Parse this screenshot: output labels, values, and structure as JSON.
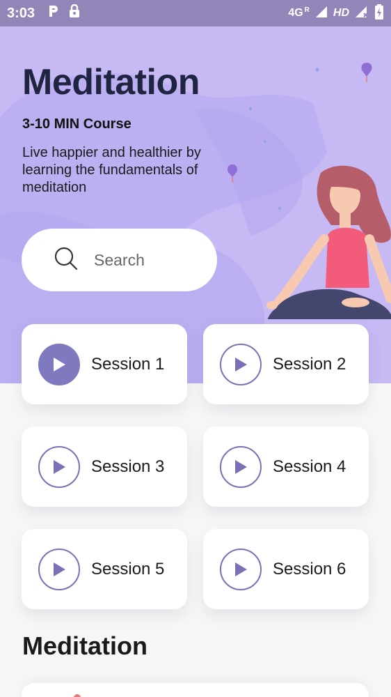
{
  "status_bar": {
    "time": "3:03",
    "network": "4G",
    "roaming": "R",
    "hd": "HD"
  },
  "hero": {
    "title": "Meditation",
    "subtitle": "3-10 MIN Course",
    "description": "Live happier and healthier by learning the fundamentals of meditation",
    "background_color": "#c6b9f4"
  },
  "search": {
    "placeholder": "Search"
  },
  "sessions": [
    {
      "label": "Session 1",
      "active": true
    },
    {
      "label": "Session 2",
      "active": false
    },
    {
      "label": "Session 3",
      "active": false
    },
    {
      "label": "Session 4",
      "active": false
    },
    {
      "label": "Session 5",
      "active": false
    },
    {
      "label": "Session 6",
      "active": false
    }
  ],
  "section": {
    "title": "Meditation"
  },
  "colors": {
    "accent": "#7f79c0",
    "title_text": "#1f2440",
    "status_bar": "#9385b8"
  },
  "icons": [
    "parking-icon",
    "lock-icon",
    "signal-icon",
    "battery-icon",
    "search-icon",
    "play-icon",
    "balloon-icon",
    "meditating-woman-illustration"
  ]
}
